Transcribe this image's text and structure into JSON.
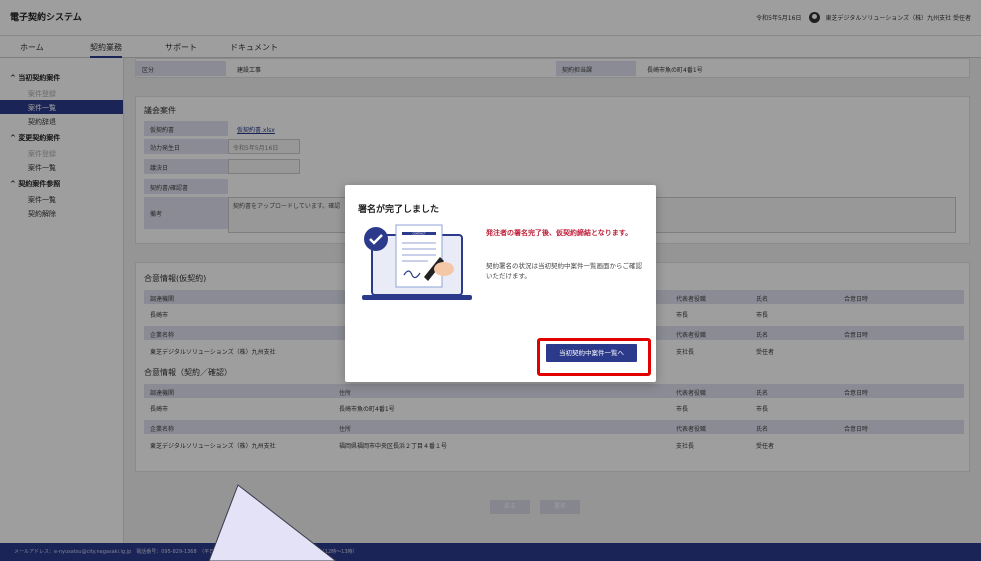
{
  "header": {
    "app_title": "電子契約システム",
    "date": "令和5年5月16日",
    "user": "東芝デジタルソリューションズ（株）九州支社 受任者"
  },
  "nav": {
    "tabs": [
      {
        "label": "ホーム"
      },
      {
        "label": "契約業務"
      },
      {
        "label": "サポート"
      },
      {
        "label": "ドキュメント"
      }
    ]
  },
  "sidebar": {
    "sections": [
      {
        "title": "当初契約案件",
        "items": [
          "案件登録",
          "案件一覧",
          "契約辞退"
        ]
      },
      {
        "title": "変更契約案件",
        "items": [
          "案件登録",
          "案件一覧"
        ]
      },
      {
        "title": "契約案件参照",
        "items": [
          "案件一覧",
          "契約解除"
        ]
      }
    ]
  },
  "top_row": {
    "kubun_label": "区分",
    "kubun_value": "建設工事",
    "tanto_label": "契約担当課",
    "tanto_value": "長崎市魚の町4番1号"
  },
  "proposal": {
    "section_title": "議会案件",
    "draft_label": "仮契約書",
    "draft_value": "仮契約書.xlsx",
    "effective_label": "効力発生日",
    "effective_value": "令和5年5月16日",
    "decision_label": "議決日",
    "contract_label": "契約書/確認書",
    "remarks_label": "備考",
    "remarks_value": "契約書をアップロードしています。確認"
  },
  "consent1": {
    "section_title": "合意情報(仮契約)",
    "headers_left": [
      "調達機関"
    ],
    "headers_right": [
      "代表者役職",
      "氏名",
      "合意日時"
    ],
    "row1_left": "長崎市",
    "row1_right": [
      "市長",
      "市長"
    ],
    "headers2_left": [
      "企業名称"
    ],
    "headers2_right": [
      "代表者役職",
      "氏名",
      "合意日時"
    ],
    "row2_left": "東芝デジタルソリューションズ（株）九州支社",
    "row2_right": [
      "支社長",
      "受任者"
    ]
  },
  "consent2": {
    "section_title": "合意情報（契約／確認）",
    "headers": [
      "調達機関",
      "住所",
      "代表者役職",
      "氏名",
      "合意日時"
    ],
    "row1": [
      "長崎市",
      "長崎市魚の町4番1号",
      "市長",
      "市長",
      ""
    ],
    "headers2": [
      "企業名称",
      "住所",
      "代表者役職",
      "氏名",
      "合意日時"
    ],
    "row2": [
      "東芝デジタルソリューションズ（株）九州支社",
      "福岡県福岡市中央区長浜２丁目４番１号",
      "支社長",
      "受任者",
      ""
    ]
  },
  "buttons": {
    "return": "戻る",
    "sign": "署名"
  },
  "footer": {
    "text": "メールアドレス：e-nyusatsu@city.nagasaki.lg.jp　電話番号：095-829-1368　（平日：8:45〜17:30）（土日祝日・年末年始を除く）（12時〜13時）"
  },
  "modal": {
    "title": "署名が完了しました",
    "warning": "発注者の署名完了後、仮契約締結となります。",
    "info": "契約署名の状況は当初契約中案件一覧画面からご確認いただけます。",
    "button": "当初契約中案件一覧へ",
    "illustration_label": "CONTRACT"
  },
  "colors": {
    "primary": "#2c3a8c",
    "warning": "#c0203a",
    "highlight": "#e10000",
    "label_bg": "#dfe1ef"
  }
}
